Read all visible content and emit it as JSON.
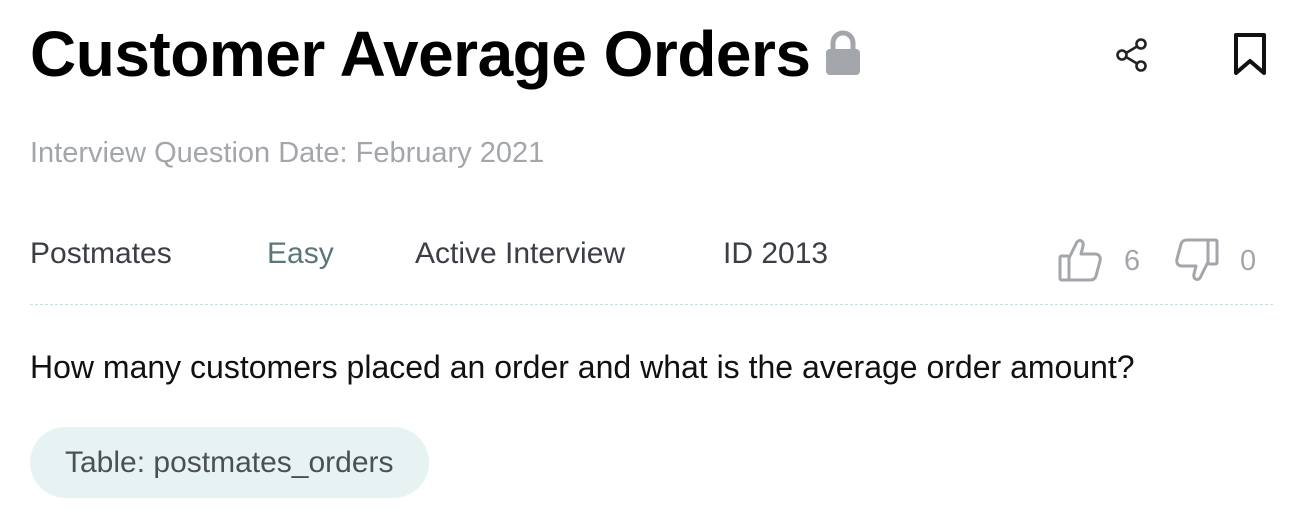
{
  "question": {
    "title": "Customer Average Orders",
    "date_line": "Interview Question Date: February 2021",
    "text": "How many customers placed an order and what is the average order amount?"
  },
  "meta": {
    "company": "Postmates",
    "difficulty": "Easy",
    "status": "Active Interview",
    "id": "ID 2013"
  },
  "votes": {
    "up": "6",
    "down": "0"
  },
  "table_badge": {
    "label": "Table: postmates_orders"
  },
  "icons": {
    "lock": "lock-icon",
    "share": "share-icon",
    "bookmark": "bookmark-icon",
    "upvote": "thumbs-up-icon",
    "downvote": "thumbs-down-icon"
  },
  "colors": {
    "muted_text": "#a3a6ab",
    "difficulty_text": "#5b7779",
    "badge_bg": "#e7f3f3",
    "divider": "#c8dfe0"
  }
}
